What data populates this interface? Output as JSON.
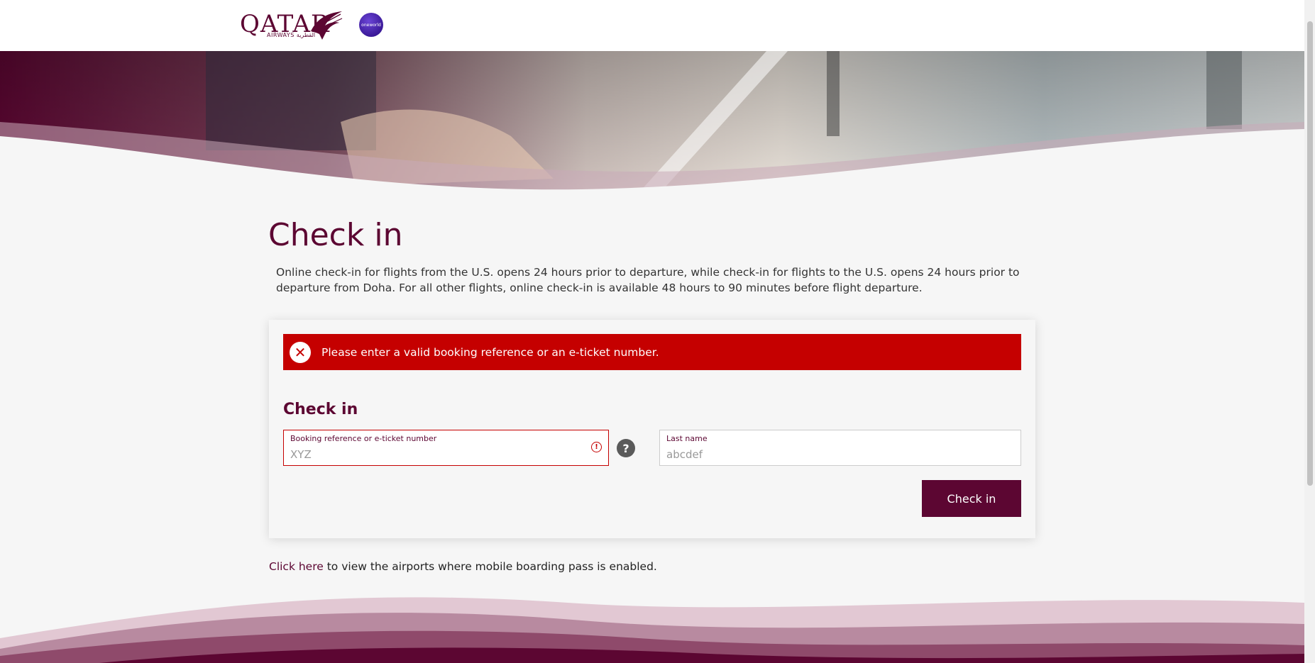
{
  "header": {
    "logo_text": "QATAR",
    "logo_sub": "AIRWAYS القطرية",
    "alliance_badge": "oneworld"
  },
  "page": {
    "title": "Check in",
    "intro": "Online check-in for flights from the U.S. opens 24 hours prior to departure, while check-in for flights to the U.S. opens 24 hours prior to departure from Doha. For all other flights, online check-in is available 48 hours to 90 minutes before flight departure."
  },
  "form": {
    "error_message": "Please enter a valid booking reference or an e-ticket number.",
    "title": "Check in",
    "booking_label": "Booking reference or e-ticket number",
    "booking_placeholder": "XYZ",
    "lastname_label": "Last name",
    "lastname_placeholder": "abcdef",
    "submit_label": "Check in"
  },
  "footer": {
    "link_text": "Click here",
    "note_text": " to view the airports where mobile boarding pass is enabled."
  },
  "icons": {
    "error": "close-circle-icon",
    "field_alert": "exclamation-circle-icon",
    "help": "question-circle-icon"
  },
  "colors": {
    "brand": "#5c0632",
    "error": "#c50000",
    "background": "#f6f6f6"
  }
}
